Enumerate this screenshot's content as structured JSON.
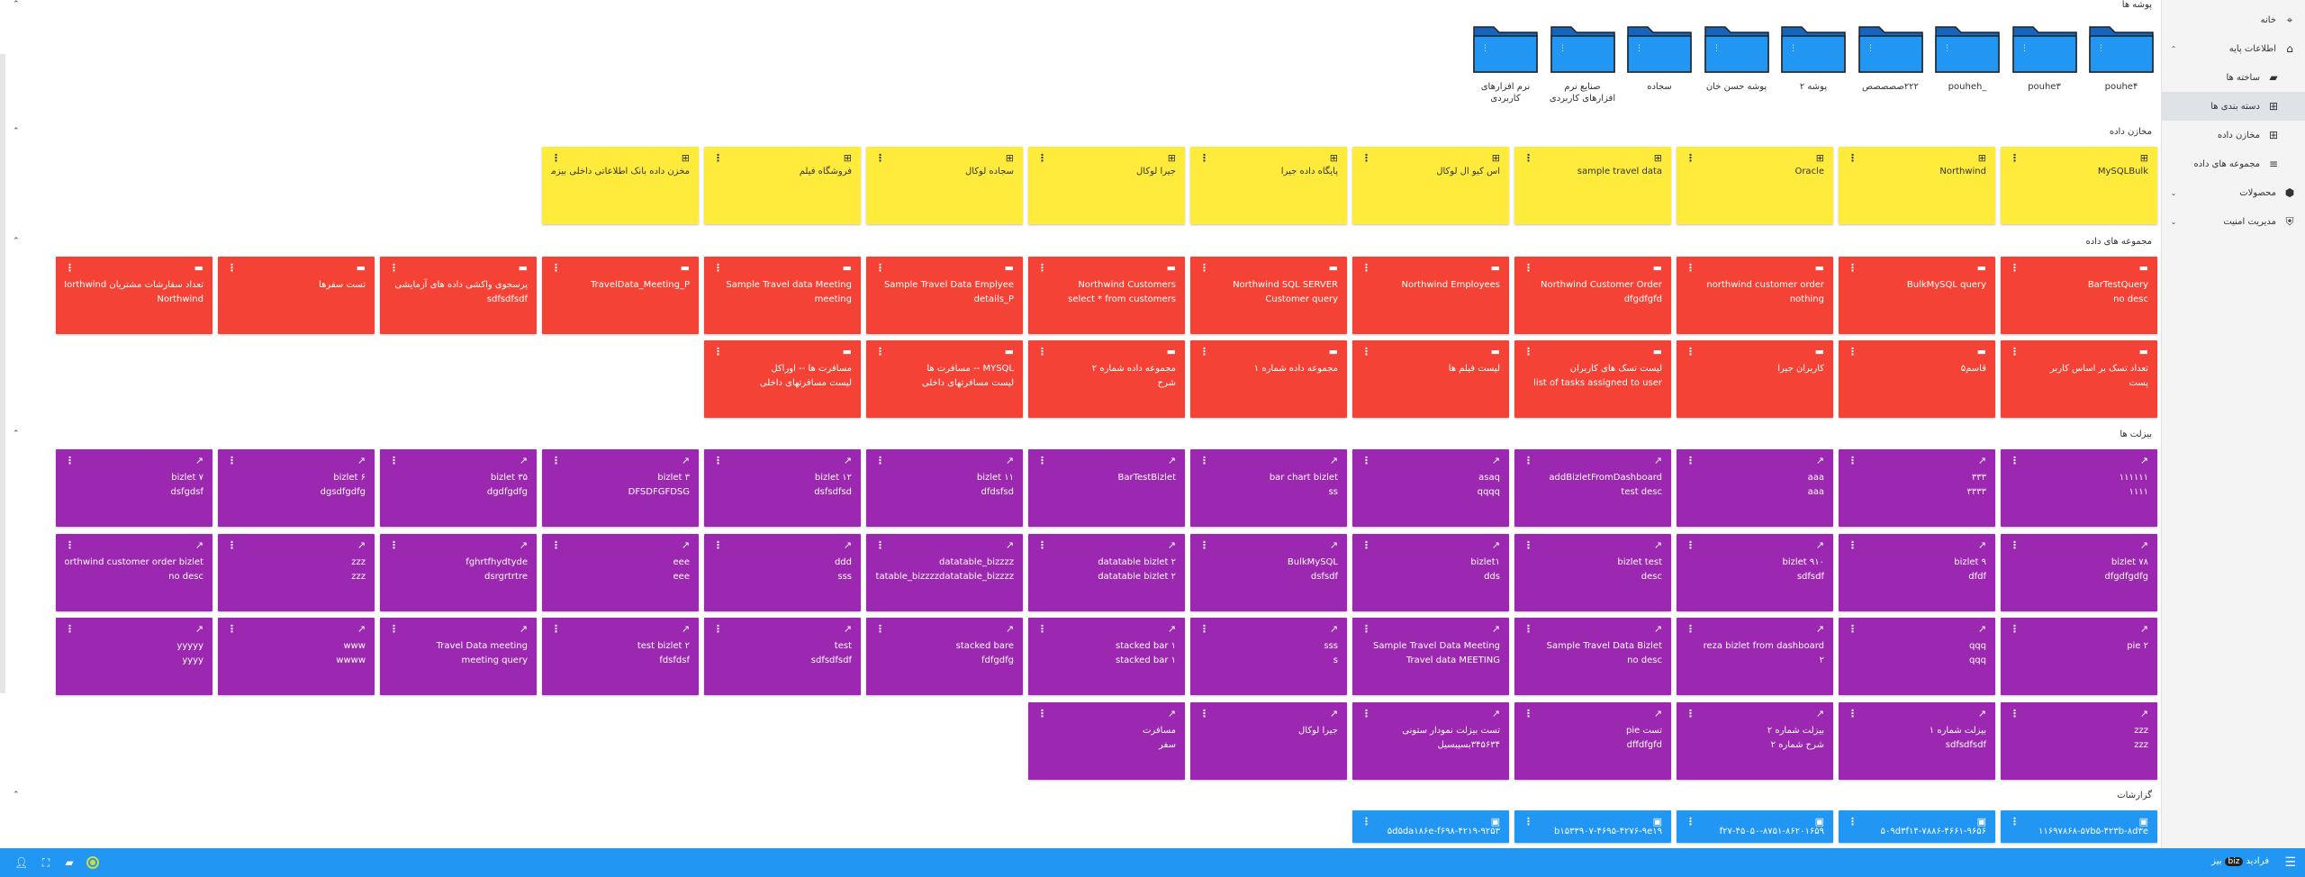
{
  "sidebar": {
    "items": [
      {
        "label": "خانه",
        "icon": "compass-icon",
        "glyph": "⌖",
        "sub": false,
        "active": false,
        "chevron": ""
      },
      {
        "label": "اطلاعات پایه",
        "icon": "bank-icon",
        "glyph": "⌂",
        "sub": false,
        "active": false,
        "chevron": "⌃"
      },
      {
        "label": "ساخته ها",
        "icon": "folder-icon",
        "glyph": "▰",
        "sub": true,
        "active": false,
        "chevron": ""
      },
      {
        "label": "دسته بندی ها",
        "icon": "grid-icon",
        "glyph": "⊞",
        "sub": true,
        "active": true,
        "chevron": ""
      },
      {
        "label": "مخازن داده",
        "icon": "database-grid-icon",
        "glyph": "⊞",
        "sub": true,
        "active": false,
        "chevron": ""
      },
      {
        "label": "مجموعه های داده",
        "icon": "list-icon",
        "glyph": "≡",
        "sub": true,
        "active": false,
        "chevron": ""
      },
      {
        "label": "محصولات",
        "icon": "shapes-icon",
        "glyph": "⬢",
        "sub": false,
        "active": false,
        "chevron": "⌄"
      },
      {
        "label": "مدیریت امنیت",
        "icon": "shield-icon",
        "glyph": "⛨",
        "sub": false,
        "active": false,
        "chevron": "⌄"
      }
    ]
  },
  "sections": {
    "folders": "پوشه ها",
    "datastores": "مخازن داده",
    "datasets": "مجموعه های داده",
    "bizlets": "بیزلت ها",
    "reports": "گزارشات"
  },
  "folders": [
    "pouhe۴",
    "pouhe۳",
    "_pouheh",
    "۲۲۲صصصصص",
    "پوشه ۲",
    "پوشه حسن خان",
    "سجاده",
    "صنایع نرم افزارهای کاربردی",
    "نرم افزارهای کاربردی"
  ],
  "datastores": [
    "MySQLBulk",
    "Northwind",
    "Oracle",
    "sample travel data",
    "اس کیو ال لوکال",
    "پایگاه داده جیرا",
    "جیرا لوکال",
    "سجاده لوکال",
    "فروشگاه فیلم",
    "مخزن داده بانک اطلاعاتی داخلی بیزموت"
  ],
  "datasets": [
    {
      "title": "BarTestQuery",
      "desc": "no desc"
    },
    {
      "title": "BulkMySQL query",
      "desc": ""
    },
    {
      "title": "northwind customer order",
      "desc": "nothing"
    },
    {
      "title": "Northwind Customer Order",
      "desc": "dfgdfgfd"
    },
    {
      "title": "Northwind Employees",
      "desc": ""
    },
    {
      "title": "Northwind SQL SERVER",
      "desc": "Customer query"
    },
    {
      "title": "Northwind Customers",
      "desc": "select * from customers"
    },
    {
      "title": "Sample Travel Data Emplyee",
      "desc": "details_P"
    },
    {
      "title": "Sample Travel data Meeting",
      "desc": "meeting"
    },
    {
      "title": "TravelData_Meeting_P",
      "desc": ""
    },
    {
      "title": "پرسجوی واکشی داده های آزمایشی",
      "desc": "sdfsdfsdf"
    },
    {
      "title": "تست سفرها",
      "desc": ""
    },
    {
      "title": "تعداد سفارشات مشتریان Northwind",
      "desc": "Northwind"
    },
    {
      "title": "تعداد تسک بر اساس کاربر",
      "desc": "پست"
    },
    {
      "title": "قاسم۵",
      "desc": ""
    },
    {
      "title": "کاربران جیرا",
      "desc": ""
    },
    {
      "title": "لیست تسک های کاربران",
      "desc": "list of tasks assigned to user"
    },
    {
      "title": "لیست فیلم ها",
      "desc": ""
    },
    {
      "title": "مجموعه داده شماره ۱",
      "desc": ""
    },
    {
      "title": "مجموعه داده شماره ۲",
      "desc": "شرح"
    },
    {
      "title": "MYSQL -- مسافرت ها",
      "desc": "لیست مسافرتهای داخلی"
    },
    {
      "title": "مسافرت ها -- اوراکل",
      "desc": "لیست مسافرتهای داخلی"
    }
  ],
  "bizlets": [
    {
      "title": "۱۱۱۱۱۱",
      "desc": "۱۱۱۱"
    },
    {
      "title": "۳۳۳",
      "desc": "۳۳۳۳"
    },
    {
      "title": "aaa",
      "desc": "aaa"
    },
    {
      "title": "addBizletFromDashboard",
      "desc": "test desc"
    },
    {
      "title": "asaq",
      "desc": "qqqq"
    },
    {
      "title": "bar chart bizlet",
      "desc": "ss"
    },
    {
      "title": "BarTestBizlet",
      "desc": ""
    },
    {
      "title": "bizlet ۱۱",
      "desc": "dfdsfsd"
    },
    {
      "title": "bizlet ۱۲",
      "desc": "dsfsdfsd"
    },
    {
      "title": "bizlet ۳",
      "desc": "DFSDFGFDSG"
    },
    {
      "title": "bizlet ۳۵",
      "desc": "dgdfgdfg"
    },
    {
      "title": "bizlet ۶",
      "desc": "dgsdfgdfg"
    },
    {
      "title": "bizlet ۷",
      "desc": "dsfgdsf"
    },
    {
      "title": "bizlet ۷۸",
      "desc": "dfgdfgdfg"
    },
    {
      "title": "bizlet ۹",
      "desc": "dfdf"
    },
    {
      "title": "bizlet ۹۱۰",
      "desc": "sdfsdf"
    },
    {
      "title": "bizlet test",
      "desc": "desc"
    },
    {
      "title": "bizlet۱",
      "desc": "dds"
    },
    {
      "title": "BulkMySQL",
      "desc": "dsfsdf"
    },
    {
      "title": "datatable bizlet ۲",
      "desc": "datatable bizlet ۲"
    },
    {
      "title": "datatable_bizzzz",
      "desc": "zzzzzdatatable_bizzzzdatatable_bizzzz"
    },
    {
      "title": "ddd",
      "desc": "sss"
    },
    {
      "title": "eee",
      "desc": "eee"
    },
    {
      "title": "fghrtfhydtyde",
      "desc": "dsrgrtrtre"
    },
    {
      "title": "zzz",
      "desc": "zzz"
    },
    {
      "title": "northwind customer order bizlet",
      "desc": "no desc"
    },
    {
      "title": "pie ۲",
      "desc": ""
    },
    {
      "title": "qqq",
      "desc": "qqq"
    },
    {
      "title": "reza bizlet from dashboard",
      "desc": "۲"
    },
    {
      "title": "Sample Travel Data Bizlet",
      "desc": "no desc"
    },
    {
      "title": "Sample Travel Data Meeting",
      "desc": "Travel data MEETING"
    },
    {
      "title": "sss",
      "desc": "s"
    },
    {
      "title": "stacked bar ۱",
      "desc": "stacked bar ۱"
    },
    {
      "title": "stacked bare",
      "desc": "fdfgdfg"
    },
    {
      "title": "test",
      "desc": "sdfsdfsdf"
    },
    {
      "title": "test bizlet ۲",
      "desc": "fdsfdsf"
    },
    {
      "title": "Travel Data meeting",
      "desc": "meeting query"
    },
    {
      "title": "www",
      "desc": "wwww"
    },
    {
      "title": "yyyyy",
      "desc": "yyyy"
    },
    {
      "title": "zzz",
      "desc": "zzz"
    },
    {
      "title": "بیزلت شماره ۱",
      "desc": "sdfsdfsdf"
    },
    {
      "title": "بیزلت شماره ۲",
      "desc": "شرح شماره ۲"
    },
    {
      "title": "تست pie",
      "desc": "dffdfgfd"
    },
    {
      "title": "تست بیزلت نمودار ستونی",
      "desc": "۳۴۵۶۳۴بسیبسیل"
    },
    {
      "title": "جیرا لوکال",
      "desc": ""
    },
    {
      "title": "مسافرت",
      "desc": "سفر"
    }
  ],
  "reports": [
    "۱۱۶۹۷۸۶۸-۵۷b۵-۴۲۳b-۸d۳e",
    "۵۰۹d۳f۱۴-۷۸۸۶-۴۶۶۱-۹۶۵۶",
    "f۲۷-۴۵۰۵۰-۸۷۵۱-۸۶۲۰۱۶۵۹",
    "b۱۵۳۳۹۰۷-۴۶۹۵-۴۲۷۶-۹e۱۹",
    "۵d۵da۱۸۶e-f۶۹۸-۴۲۱۹-۹۲۵۳"
  ],
  "footer": {
    "brand": "فرادید",
    "logo_text": "biz",
    "brand_suffix": "بیز"
  },
  "colors": {
    "accent": "#2196f3",
    "datastore": "#ffeb3b",
    "dataset": "#f44336",
    "bizlet": "#9c27b0",
    "report": "#2196f3",
    "folder": "#2196f3"
  }
}
